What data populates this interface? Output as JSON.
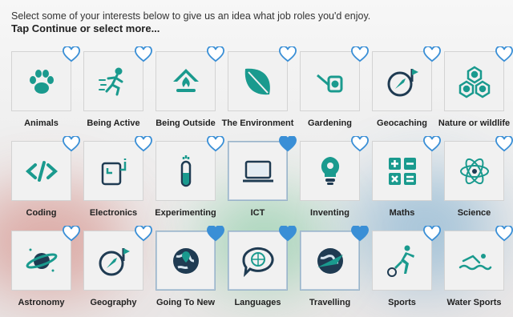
{
  "intro": {
    "line1": "Select some of your interests below to give us an idea what job roles you'd enjoy.",
    "line2": "Tap Continue or select more..."
  },
  "colors": {
    "icon": "#1a9a8e",
    "heart": "#3a8fd6",
    "icon_dark": "#1f3b52"
  },
  "interests": [
    {
      "label": "Animals",
      "icon": "paw-icon",
      "selected": false
    },
    {
      "label": "Being Active",
      "icon": "running-person-icon",
      "selected": false
    },
    {
      "label": "Being Outside",
      "icon": "campfire-tent-icon",
      "selected": false
    },
    {
      "label": "The Environment",
      "icon": "leaf-icon",
      "selected": false
    },
    {
      "label": "Gardening",
      "icon": "watering-can-icon",
      "selected": false
    },
    {
      "label": "Geocaching",
      "icon": "compass-flag-icon",
      "selected": false
    },
    {
      "label": "Nature or wildlife",
      "icon": "hexagon-nature-icon",
      "selected": false
    },
    {
      "label": "Coding",
      "icon": "code-brackets-icon",
      "selected": false
    },
    {
      "label": "Electronics",
      "icon": "circuit-board-icon",
      "selected": false
    },
    {
      "label": "Experimenting",
      "icon": "test-tube-icon",
      "selected": false
    },
    {
      "label": "ICT",
      "icon": "laptop-icon",
      "selected": true
    },
    {
      "label": "Inventing",
      "icon": "lightbulb-gear-icon",
      "selected": false
    },
    {
      "label": "Maths",
      "icon": "calculator-symbols-icon",
      "selected": false
    },
    {
      "label": "Science",
      "icon": "atom-icon",
      "selected": false
    },
    {
      "label": "Astronomy",
      "icon": "planet-icon",
      "selected": false
    },
    {
      "label": "Geography",
      "icon": "compass-flag-icon",
      "selected": false
    },
    {
      "label": "Going To New",
      "icon": "globe-pin-icon",
      "selected": true
    },
    {
      "label": "Languages",
      "icon": "speech-globe-icon",
      "selected": true
    },
    {
      "label": "Travelling",
      "icon": "globe-plane-icon",
      "selected": true
    },
    {
      "label": "Sports",
      "icon": "football-player-icon",
      "selected": false
    },
    {
      "label": "Water Sports",
      "icon": "swimmer-icon",
      "selected": false
    }
  ]
}
